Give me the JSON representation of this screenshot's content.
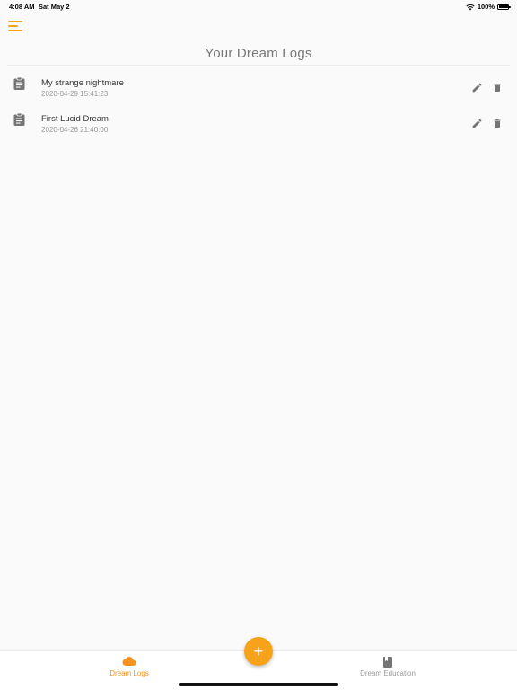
{
  "status_bar": {
    "time": "4:08 AM",
    "date": "Sat May 2",
    "battery": "100%"
  },
  "header": {
    "title": "Your Dream Logs",
    "menu_icon": "hamburger-menu-icon"
  },
  "logs": [
    {
      "title": "My strange nightmare",
      "date": "2020-04-29 15:41:23"
    },
    {
      "title": "First Lucid Dream",
      "date": "2020-04-26 21:40:00"
    }
  ],
  "bottom_nav": {
    "tabs": [
      {
        "label": "Dream Logs",
        "icon": "cloud-icon",
        "active": true
      },
      {
        "label": "Dream Education",
        "icon": "book-icon",
        "active": false
      }
    ],
    "fab_label": "+"
  },
  "colors": {
    "accent": "#f7a21b",
    "accent_text": "#f7931e",
    "inactive": "#9a9a9a",
    "icon_gray": "#757575",
    "background": "#fafafa"
  }
}
